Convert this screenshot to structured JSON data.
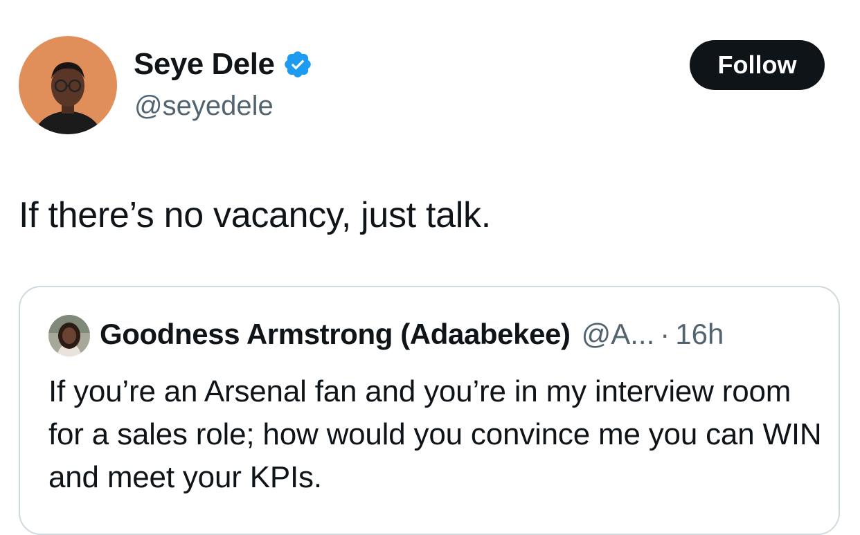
{
  "tweet": {
    "author": {
      "name": "Seye Dele",
      "handle": "@seyedele",
      "verified_icon": "verified-badge-icon",
      "avatar_bg": "#e08f5b"
    },
    "follow_label": "Follow",
    "text": "If there’s no vacancy, just talk."
  },
  "quoted": {
    "name": "Goodness Armstrong (Adaabekee)",
    "handle": "@A...",
    "separator": "·",
    "time": "16h",
    "text": "If you’re an Arsenal fan and you’re in my interview room for a sales role; how would you convince me you can WIN and meet your KPIs."
  },
  "colors": {
    "verified": "#1d9bf0",
    "follow_bg": "#0f1419",
    "secondary_text": "#536471",
    "border": "#cfd9de"
  }
}
